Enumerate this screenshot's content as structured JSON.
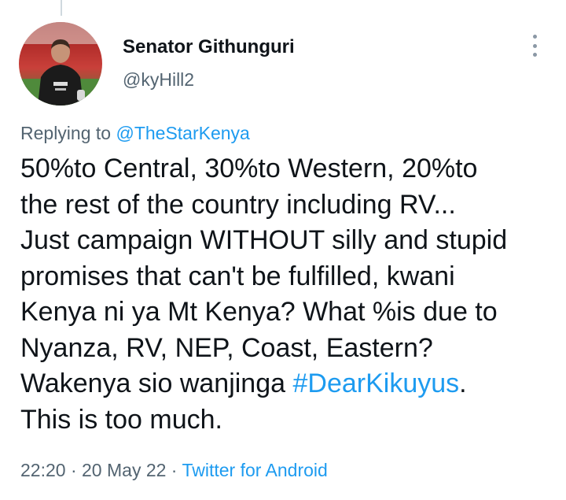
{
  "author": {
    "display_name": "Senator Githunguri",
    "handle": "@kyHill2"
  },
  "reply_context": {
    "prefix": "Replying to ",
    "mention": "@TheStarKenya"
  },
  "tweet": {
    "lines": [
      "50%to Central, 30%to Western, 20%to",
      "the rest of the country including RV...",
      "Just campaign WITHOUT silly and stupid",
      "promises that can't be fulfilled, kwani",
      "Kenya ni ya Mt Kenya? What %is due to",
      "Nyanza, RV, NEP, Coast, Eastern?"
    ],
    "line7_prefix": "Wakenya sio wanjinga ",
    "hashtag": "#DearKikuyus",
    "line7_suffix": ".",
    "last_line": "This is too much."
  },
  "meta": {
    "time": "22:20",
    "separator1": " · ",
    "date": "20 May 22",
    "separator2": " · ",
    "source": "Twitter for Android"
  },
  "colors": {
    "link": "#1d9bf0",
    "secondary_text": "#536471",
    "primary_text": "#0f1419"
  },
  "icons": {
    "more": "vertical-ellipsis-icon"
  }
}
